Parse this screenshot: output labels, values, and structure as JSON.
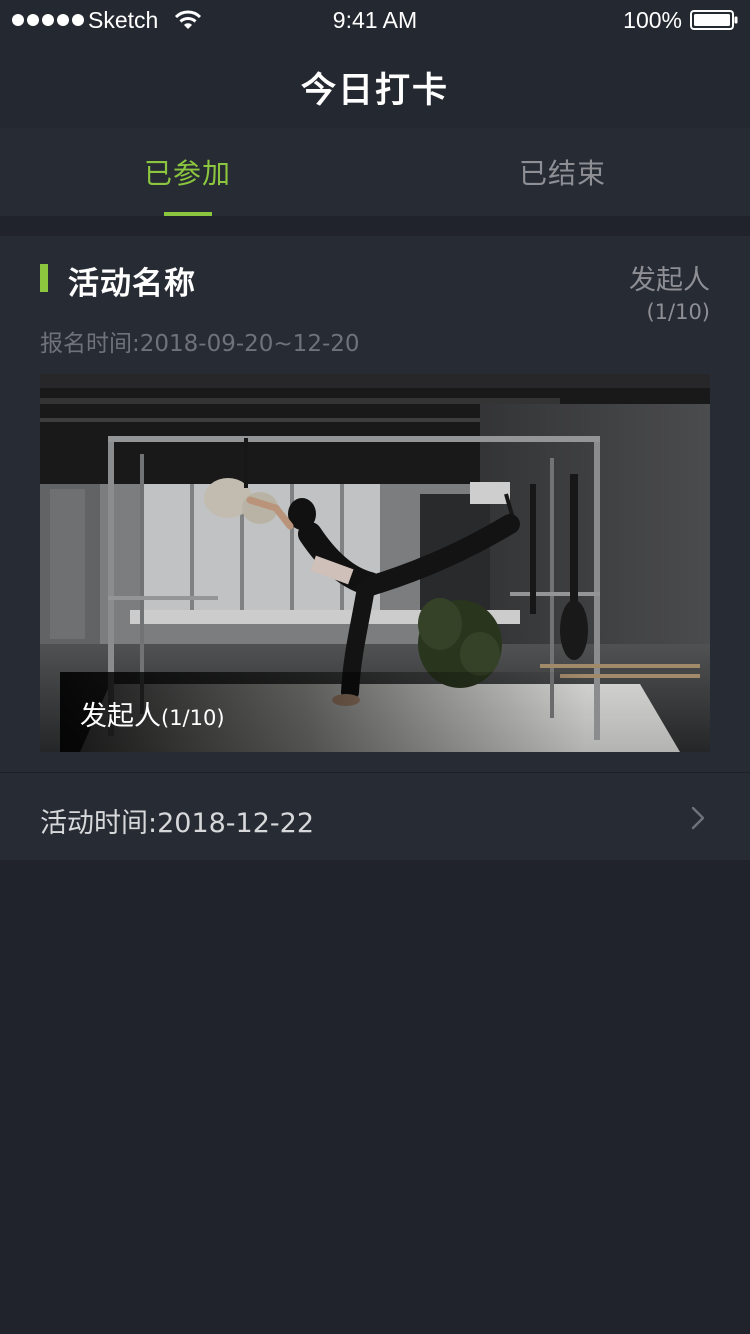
{
  "status_bar": {
    "carrier": "Sketch",
    "time": "9:41 AM",
    "battery_percent": "100%",
    "signal_icon": "signal-dots-icon",
    "wifi_icon": "wifi-icon",
    "battery_icon": "battery-icon",
    "battery_level": 1.0
  },
  "nav": {
    "title": "今日打卡"
  },
  "tabs": [
    {
      "label": "已参加",
      "active": true
    },
    {
      "label": "已结束",
      "active": false
    }
  ],
  "card": {
    "name": "活动名称",
    "initiator": "发起人",
    "initiator_count": "(1/10)",
    "signup_time": "报名时间:2018-09-20~12-20",
    "photo_caption": "发起人",
    "photo_caption_count": "(1/10)",
    "activity_time": "活动时间:2018-12-22",
    "chevron_icon": "chevron-right-icon"
  },
  "colors": {
    "accent": "#8cc63f",
    "background": "#20232c",
    "surface": "#272b34",
    "muted_text": "#8d8f94"
  }
}
